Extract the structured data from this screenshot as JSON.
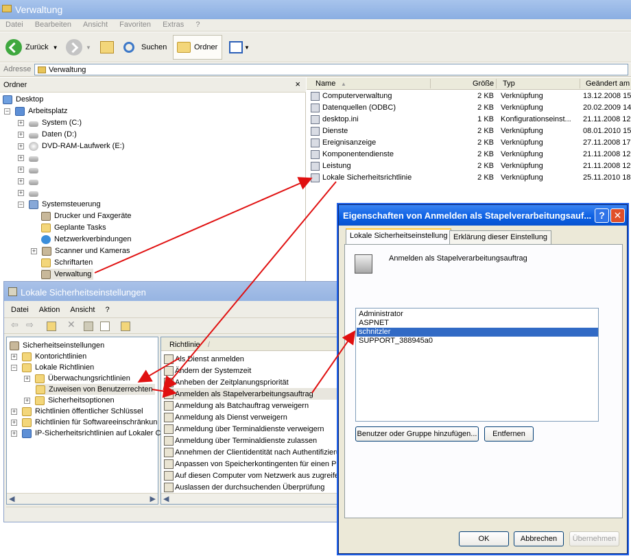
{
  "explorer": {
    "title": "Verwaltung",
    "menu": [
      "Datei",
      "Bearbeiten",
      "Ansicht",
      "Favoriten",
      "Extras",
      "?"
    ],
    "toolbar": {
      "back": "Zurück",
      "search": "Suchen",
      "folders": "Ordner"
    },
    "address_label": "Adresse",
    "address_value": "Verwaltung",
    "folders_header": "Ordner",
    "close_glyph": "×",
    "tree": {
      "desktop": "Desktop",
      "arbeitsplatz": "Arbeitsplatz",
      "system": "System (C:)",
      "daten": "Daten (D:)",
      "dvd": "DVD-RAM-Laufwerk (E:)",
      "systemsteuerung": "Systemsteuerung",
      "drucker": "Drucker und Faxgeräte",
      "geplant": "Geplante Tasks",
      "netz": "Netzwerkverbindungen",
      "scanner": "Scanner und Kameras",
      "schriftarten": "Schriftarten",
      "verwaltung": "Verwaltung"
    },
    "columns": {
      "name": "Name",
      "size": "Größe",
      "type": "Typ",
      "changed": "Geändert am"
    },
    "files": [
      {
        "name": "Computerverwaltung",
        "size": "2 KB",
        "type": "Verknüpfung",
        "changed": "13.12.2008 15"
      },
      {
        "name": "Datenquellen (ODBC)",
        "size": "2 KB",
        "type": "Verknüpfung",
        "changed": "20.02.2009 14"
      },
      {
        "name": "desktop.ini",
        "size": "1 KB",
        "type": "Konfigurationseinst...",
        "changed": "21.11.2008 12"
      },
      {
        "name": "Dienste",
        "size": "2 KB",
        "type": "Verknüpfung",
        "changed": "08.01.2010 15"
      },
      {
        "name": "Ereignisanzeige",
        "size": "2 KB",
        "type": "Verknüpfung",
        "changed": "27.11.2008 17"
      },
      {
        "name": "Komponentendienste",
        "size": "2 KB",
        "type": "Verknüpfung",
        "changed": "21.11.2008 12"
      },
      {
        "name": "Leistung",
        "size": "2 KB",
        "type": "Verknüpfung",
        "changed": "21.11.2008 12"
      },
      {
        "name": "Lokale Sicherheitsrichtlinie",
        "size": "2 KB",
        "type": "Verknüpfung",
        "changed": "25.11.2010 18"
      }
    ]
  },
  "lsw": {
    "title": "Lokale Sicherheitseinstellungen",
    "menu": [
      "Datei",
      "Aktion",
      "Ansicht",
      "?"
    ],
    "tree": {
      "root": "Sicherheitseinstellungen",
      "konto": "Kontorichtlinien",
      "lokal": "Lokale Richtlinien",
      "ueberwachung": "Überwachungsrichtlinien",
      "zuweisen": "Zuweisen von Benutzerrechten",
      "sicherheit": "Sicherheitsoptionen",
      "oeffentlich": "Richtlinien öffentlicher Schlüssel",
      "software": "Richtlinien für Softwareeinschränkun",
      "ipsec": "IP-Sicherheitsrichtlinien auf Lokaler C"
    },
    "list_header": "Richtlinie",
    "sort_glyph": "/",
    "policies": [
      "Als Dienst anmelden",
      "Ändern der Systemzeit",
      "Anheben der Zeitplanungspriorität",
      "Anmelden als Stapelverarbeitungsauftrag",
      "Anmeldung als Batchauftrag verweigern",
      "Anmeldung als Dienst verweigern",
      "Anmeldung über Terminaldienste verweigern",
      "Anmeldung über Terminaldienste zulassen",
      "Annehmen der Clientidentität nach Authentifizieru",
      "Anpassen von Speicherkontingenten für einen Pro",
      "Auf diesen Computer vom Netzwerk aus zugreifen",
      "Auslassen der durchsuchenden Überprüfung"
    ]
  },
  "dialog": {
    "title": "Eigenschaften von Anmelden als Stapelverarbeitungsauf...",
    "help": "?",
    "close": "✕",
    "tab1": "Lokale Sicherheitseinstellung",
    "tab2": "Erklärung dieser Einstellung",
    "policy": "Anmelden als Stapelverarbeitungsauftrag",
    "users": [
      "Administrator",
      "ASPNET",
      "schnitzler",
      "SUPPORT_388945a0"
    ],
    "add_button": "Benutzer oder Gruppe hinzufügen...",
    "remove_button": "Entfernen",
    "ok": "OK",
    "cancel": "Abbrechen",
    "apply": "Übernehmen"
  },
  "colors": {
    "accent_red": "#e01010",
    "selection": "#316ac5",
    "xp_blue": "#0a5fe2"
  }
}
